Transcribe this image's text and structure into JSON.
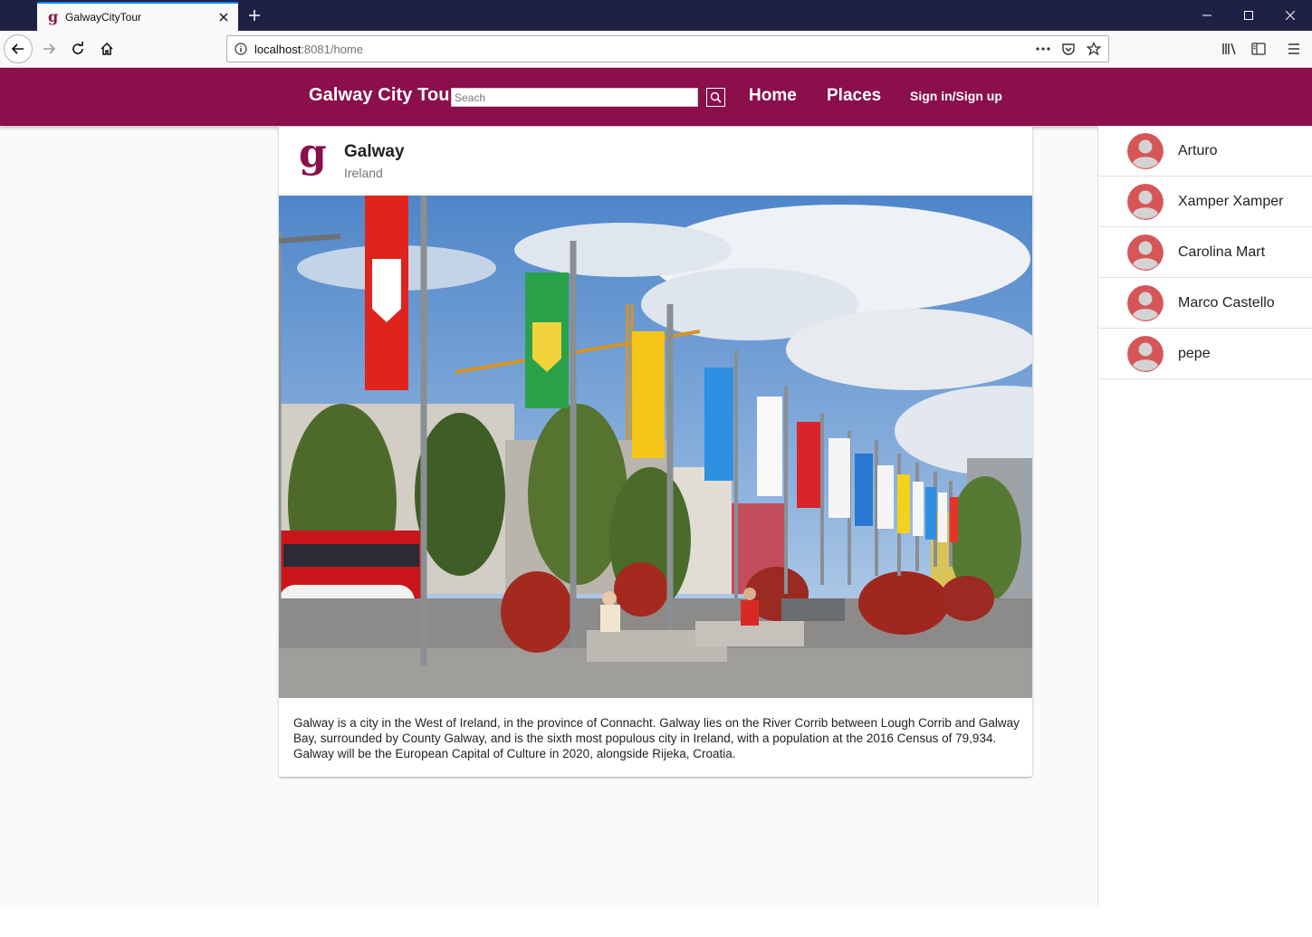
{
  "browser": {
    "tab_title": "GalwayCityTour",
    "tab_favicon_letter": "g",
    "url_host": "localhost",
    "url_path": ":8081/home",
    "icons": [
      "back-icon",
      "forward-icon",
      "reload-icon",
      "home-icon",
      "info-icon",
      "more-icon",
      "pocket-icon",
      "bookmark-star-icon",
      "library-icon",
      "sidebar-icon",
      "menu-icon",
      "close-icon",
      "plus-icon",
      "minimize-icon",
      "maximize-icon"
    ]
  },
  "app": {
    "brand": "Galway City Tour",
    "search_placeholder": "Seach",
    "nav": {
      "home": "Home",
      "places": "Places",
      "sign": "Sign in/Sign up"
    },
    "accent_color": "#8a0f4a"
  },
  "place": {
    "logo_letter": "g",
    "title": "Galway",
    "subtitle": "Ireland",
    "description": "Galway is a city in the West of Ireland, in the province of Connacht. Galway lies on the River Corrib between Lough Corrib and Galway Bay, surrounded by County Galway, and is the sixth most populous city in Ireland, with a population at the 2016 Census of 79,934. Galway will be the European Capital of Culture in 2020, alongside Rijeka, Croatia."
  },
  "users": [
    {
      "name": "Arturo"
    },
    {
      "name": "Xamper Xamper"
    },
    {
      "name": "Carolina Mart"
    },
    {
      "name": "Marco Castello"
    },
    {
      "name": "pepe"
    }
  ]
}
